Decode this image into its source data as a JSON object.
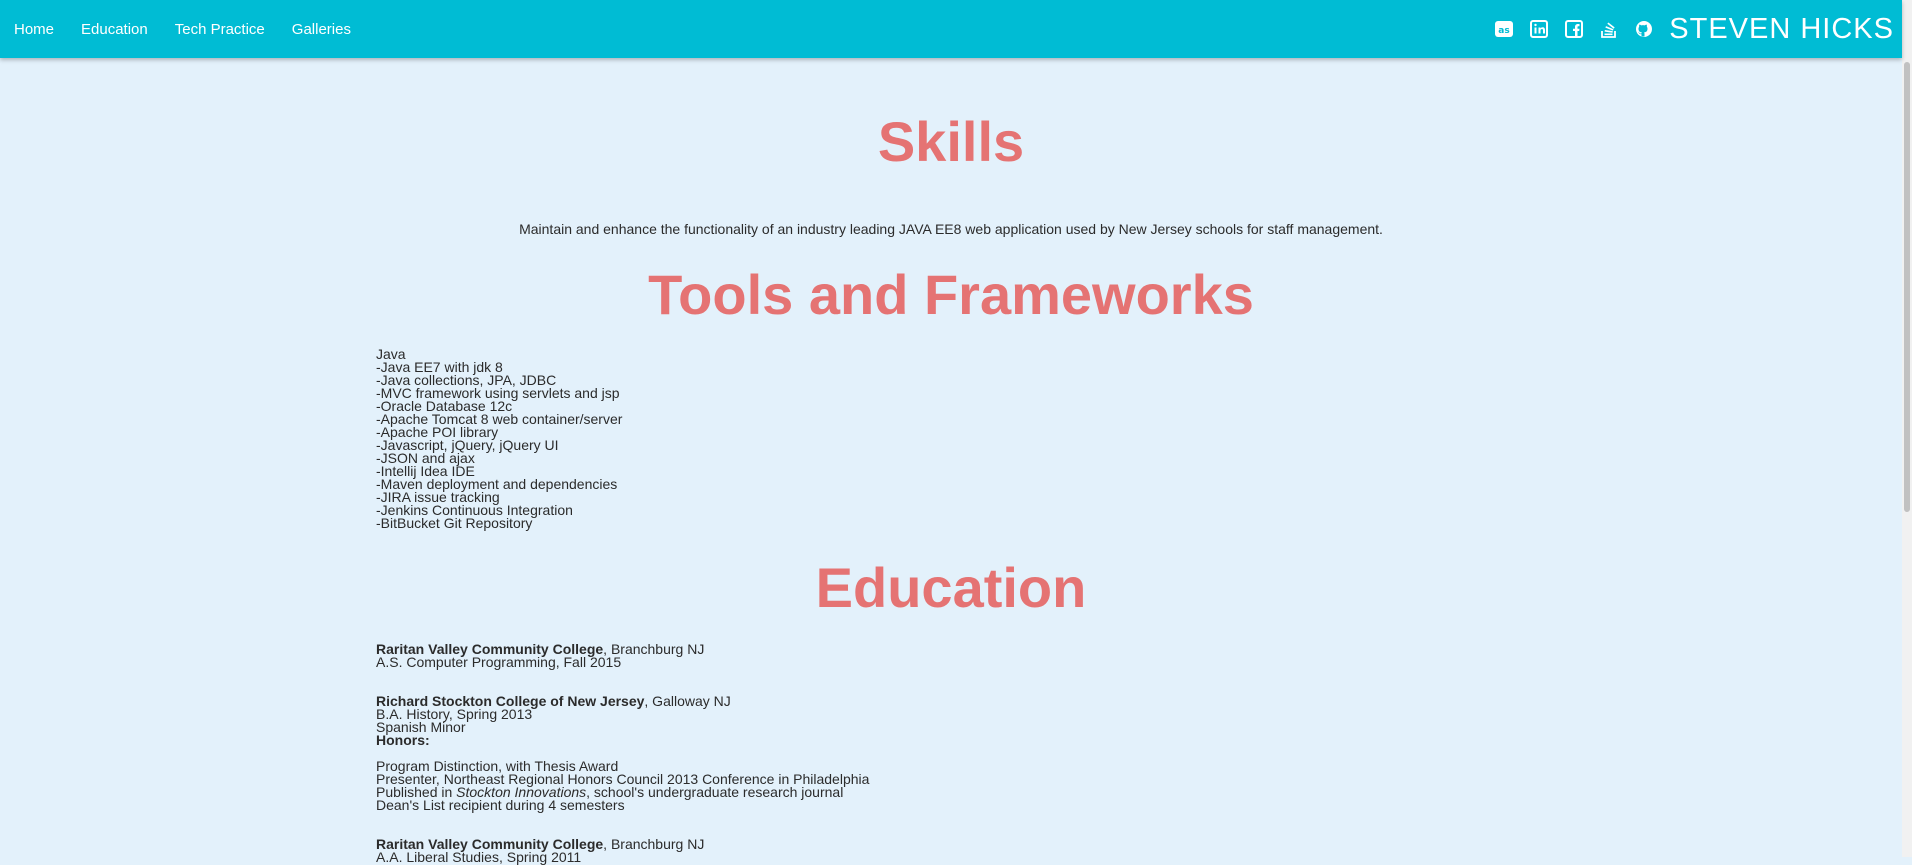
{
  "header": {
    "nav": [
      "Home",
      "Education",
      "Tech Practice",
      "Galleries"
    ],
    "brand": "STEVEN HICKS",
    "social_icons": [
      "lastfm-icon",
      "linkedin-icon",
      "facebook-icon",
      "stackoverflow-icon",
      "github-icon"
    ],
    "bar_color": "#00bcd4"
  },
  "skills": {
    "heading": "Skills",
    "description": "Maintain and enhance the functionality of an industry leading JAVA EE8 web application used by New Jersey schools for staff management."
  },
  "tools": {
    "heading": "Tools and Frameworks",
    "items": [
      "Java",
      "-Java EE7 with jdk 8",
      "-Java collections, JPA, JDBC",
      "-MVC framework using servlets and jsp",
      "-Oracle Database 12c",
      "-Apache Tomcat 8 web container/server",
      "-Apache POI library",
      "-Javascript, jQuery, jQuery UI",
      "-JSON and ajax",
      "-Intellij Idea IDE",
      "-Maven deployment and dependencies",
      "-JIRA issue tracking",
      "-Jenkins Continuous Integration",
      "-BitBucket Git Repository"
    ]
  },
  "education": {
    "heading": "Education",
    "school1_name": "Raritan Valley Community College",
    "school1_location": ", Branchburg NJ",
    "school1_degree": "A.S. Computer Programming, Fall 2015",
    "school2_name": "Richard Stockton College of New Jersey",
    "school2_location": ", Galloway NJ",
    "school2_degree": "B.A. History, Spring 2013",
    "school2_minor": "Spanish Minor",
    "honors_label": "Honors:",
    "honor1": "Program Distinction, with Thesis Award",
    "honor2": "Presenter, Northeast Regional Honors Council 2013 Conference in Philadelphia",
    "honor3_prefix": "Published in ",
    "honor3_journal": "Stockton Innovations",
    "honor3_suffix": ", school's undergraduate research journal",
    "honor4": "Dean's List recipient during 4 semesters",
    "school3_name": "Raritan Valley Community College",
    "school3_location": ", Branchburg NJ",
    "school3_degree": "A.A. Liberal Studies, Spring 2011"
  },
  "colors": {
    "heading": "#e57373",
    "background": "#e3f1fb"
  }
}
